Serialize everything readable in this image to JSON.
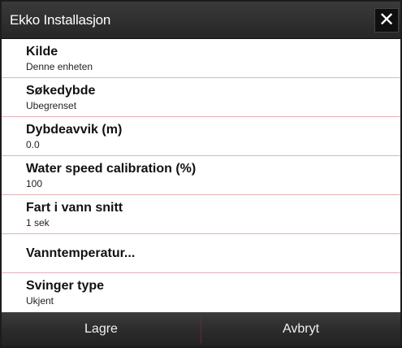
{
  "dialog": {
    "title": "Ekko Installasjon",
    "close_glyph": "✕"
  },
  "rows": [
    {
      "label": "Kilde",
      "value": "Denne enheten"
    },
    {
      "label": "Søkedybde",
      "value": "Ubegrenset"
    },
    {
      "label": "Dybdeavvik (m)",
      "value": "0.0"
    },
    {
      "label": "Water speed calibration (%)",
      "value": "100"
    },
    {
      "label": "Fart i vann snitt",
      "value": "1 sek"
    },
    {
      "label": "Vanntemperatur..."
    },
    {
      "label": "Svinger type",
      "value": "Ukjent"
    }
  ],
  "footer": {
    "save_label": "Lagre",
    "cancel_label": "Avbryt"
  },
  "colors": {
    "titlebar": "#2e2e2e",
    "row_divider": "#e6b0b8",
    "footer": "#2c2c2c"
  }
}
